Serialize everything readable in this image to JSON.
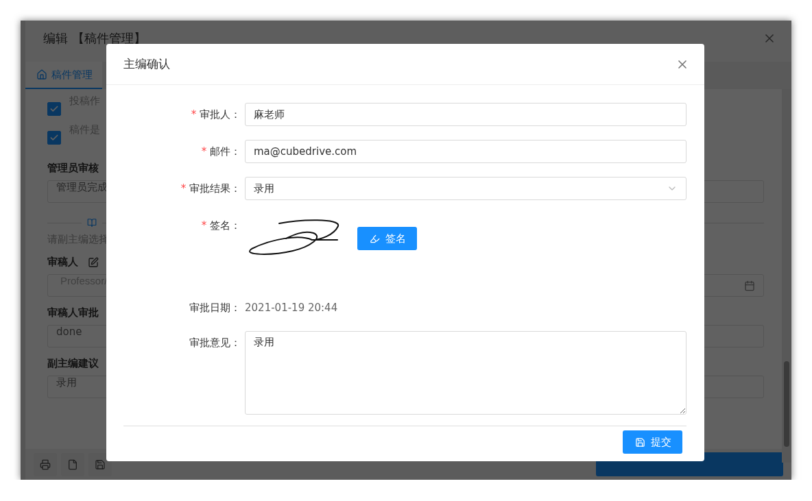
{
  "editor": {
    "title": "编辑 【稿件管理】",
    "tabs": [
      {
        "label": "稿件管理",
        "selected": true
      }
    ],
    "checks": [
      {
        "label": "投稿作",
        "checked": true
      },
      {
        "label": "稿件是",
        "checked": true
      }
    ],
    "items": [
      {
        "kind": "heading",
        "label": "管理员审核"
      },
      {
        "kind": "input",
        "value": "管理员完成"
      },
      {
        "kind": "divider"
      },
      {
        "kind": "note",
        "text": "请副主编选择"
      },
      {
        "kind": "heading",
        "label": "审稿人",
        "editable": true
      },
      {
        "kind": "date",
        "value": "Professor/"
      },
      {
        "kind": "heading",
        "label": "审稿人审批"
      },
      {
        "kind": "input",
        "value": "done"
      },
      {
        "kind": "heading",
        "label": "副主编建议"
      },
      {
        "kind": "input",
        "value": "录用"
      }
    ]
  },
  "dialog": {
    "title": "主编确认",
    "fields": [
      {
        "kind": "input",
        "label": "审批人：",
        "required_mark": "*",
        "value": "麻老师"
      },
      {
        "kind": "input",
        "label": "邮件：",
        "required_mark": "*",
        "value": "ma@cubedrive.com"
      },
      {
        "kind": "select",
        "label": "审批结果：",
        "required_mark": "*",
        "value": "录用"
      },
      {
        "kind": "signature",
        "label": "签名：",
        "required_mark": "*",
        "button": "签名"
      },
      {
        "kind": "text",
        "label": "审批日期：",
        "value": "2021-01-19 20:44"
      },
      {
        "kind": "textarea",
        "label": "审批意见：",
        "value": "录用"
      }
    ],
    "submit": "提交"
  }
}
